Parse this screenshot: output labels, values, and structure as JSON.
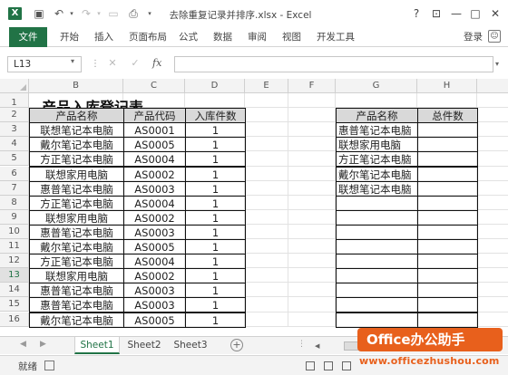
{
  "window": {
    "title": "去除重复记录并排序.xlsx - Excel",
    "logo_glyph": "X",
    "help_glyph": "?",
    "restore_glyph": "⊡",
    "minimize_glyph": "—",
    "maximize_glyph": "□",
    "close_glyph": "✕"
  },
  "ribbon": {
    "tabs": [
      "文件",
      "开始",
      "插入",
      "页面布局",
      "公式",
      "数据",
      "审阅",
      "视图",
      "开发工具"
    ],
    "login_label": "登录",
    "accent_color": "#217346"
  },
  "formula_bar": {
    "name_box": "L13",
    "fx_label": "fx",
    "formula": ""
  },
  "columns": [
    "B",
    "C",
    "D",
    "E",
    "F",
    "G",
    "H"
  ],
  "rows": [
    "1",
    "2",
    "3",
    "4",
    "5",
    "6",
    "7",
    "8",
    "9",
    "10",
    "11",
    "12",
    "13",
    "14",
    "15",
    "16"
  ],
  "selected_row": "13",
  "sheet": {
    "title": "产品入库登记表",
    "left_table": {
      "headers": [
        "产品名称",
        "产品代码",
        "入库件数"
      ],
      "rows": [
        [
          "联想笔记本电脑",
          "AS0001",
          "1"
        ],
        [
          "戴尔笔记本电脑",
          "AS0005",
          "1"
        ],
        [
          "方正笔记本电脑",
          "AS0004",
          "1"
        ],
        [
          "联想家用电脑",
          "AS0002",
          "1"
        ],
        [
          "惠普笔记本电脑",
          "AS0003",
          "1"
        ],
        [
          "方正笔记本电脑",
          "AS0004",
          "1"
        ],
        [
          "联想家用电脑",
          "AS0002",
          "1"
        ],
        [
          "惠普笔记本电脑",
          "AS0003",
          "1"
        ],
        [
          "戴尔笔记本电脑",
          "AS0005",
          "1"
        ],
        [
          "方正笔记本电脑",
          "AS0004",
          "1"
        ],
        [
          "联想家用电脑",
          "AS0002",
          "1"
        ],
        [
          "惠普笔记本电脑",
          "AS0003",
          "1"
        ],
        [
          "惠普笔记本电脑",
          "AS0003",
          "1"
        ],
        [
          "戴尔笔记本电脑",
          "AS0005",
          "1"
        ]
      ]
    },
    "right_table": {
      "headers": [
        "产品名称",
        "总件数"
      ],
      "rows": [
        [
          "惠普笔记本电脑",
          ""
        ],
        [
          "联想家用电脑",
          ""
        ],
        [
          "方正笔记本电脑",
          ""
        ],
        [
          "戴尔笔记本电脑",
          ""
        ],
        [
          "联想笔记本电脑",
          ""
        ],
        [
          "",
          ""
        ],
        [
          "",
          ""
        ],
        [
          "",
          ""
        ],
        [
          "",
          ""
        ],
        [
          "",
          ""
        ],
        [
          "",
          ""
        ],
        [
          "",
          ""
        ],
        [
          "",
          ""
        ],
        [
          "",
          ""
        ]
      ]
    }
  },
  "sheet_tabs": [
    "Sheet1",
    "Sheet2",
    "Sheet3"
  ],
  "active_sheet": "Sheet1",
  "status": {
    "text": "就绪"
  },
  "watermark": {
    "brand": "Office办公助手",
    "url": "www.officezhushou.com"
  }
}
